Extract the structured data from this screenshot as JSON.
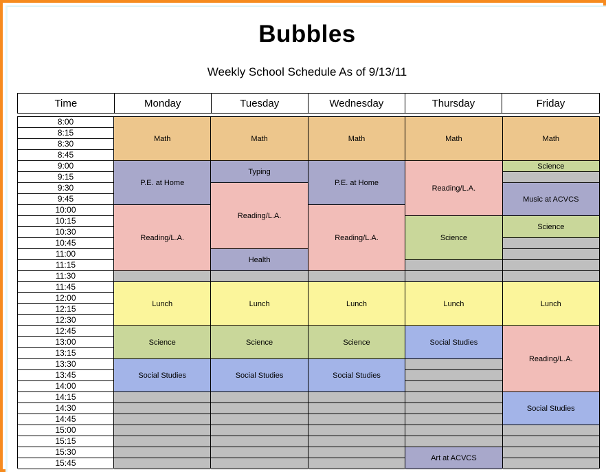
{
  "document": {
    "title": "Bubbles",
    "subtitle": "Weekly School Schedule As of 9/13/11",
    "frame_color": "#f68b1f"
  },
  "table": {
    "columns": [
      "Time",
      "Monday",
      "Tuesday",
      "Wednesday",
      "Thursday",
      "Friday"
    ],
    "times": [
      "8:00",
      "8:15",
      "8:30",
      "8:45",
      "9:00",
      "9:15",
      "9:30",
      "9:45",
      "10:00",
      "10:15",
      "10:30",
      "10:45",
      "11:00",
      "11:15",
      "11:30",
      "11:45",
      "12:00",
      "12:15",
      "12:30",
      "12:45",
      "13:00",
      "13:15",
      "13:30",
      "13:45",
      "14:00",
      "14:15",
      "14:30",
      "14:45",
      "15:00",
      "15:15",
      "15:30",
      "15:45"
    ],
    "slot_count": 32,
    "subject_colors": {
      "Math": "#edc68c",
      "P.E. at Home": "#a8a8cb",
      "Typing": "#a8a8cb",
      "Health": "#a8a8cb",
      "Music at ACVCS": "#a8a8cb",
      "Art at ACVCS": "#a8a8cb",
      "Reading/L.A.": "#f2bdb8",
      "Lunch": "#fbf59b",
      "Science": "#c9d79a",
      "Social Studies": "#a3b4e8",
      "empty": "#bfbfbf"
    },
    "days": [
      {
        "name": "Monday",
        "blocks": [
          {
            "label": "Math",
            "start": 0,
            "span": 4,
            "color": "#edc68c"
          },
          {
            "label": "P.E. at Home",
            "start": 4,
            "span": 4,
            "color": "#a8a8cb"
          },
          {
            "label": "Reading/L.A.",
            "start": 8,
            "span": 6,
            "color": "#f2bdb8"
          },
          {
            "label": "",
            "start": 14,
            "span": 1,
            "color": "#bfbfbf"
          },
          {
            "label": "Lunch",
            "start": 15,
            "span": 4,
            "color": "#fbf59b"
          },
          {
            "label": "Science",
            "start": 19,
            "span": 3,
            "color": "#c9d79a"
          },
          {
            "label": "Social Studies",
            "start": 22,
            "span": 3,
            "color": "#a3b4e8"
          },
          {
            "label": "",
            "start": 25,
            "span": 7,
            "color": "#bfbfbf"
          }
        ]
      },
      {
        "name": "Tuesday",
        "blocks": [
          {
            "label": "Math",
            "start": 0,
            "span": 4,
            "color": "#edc68c"
          },
          {
            "label": "Typing",
            "start": 4,
            "span": 2,
            "color": "#a8a8cb"
          },
          {
            "label": "Reading/L.A.",
            "start": 6,
            "span": 6,
            "color": "#f2bdb8"
          },
          {
            "label": "Health",
            "start": 12,
            "span": 2,
            "color": "#a8a8cb"
          },
          {
            "label": "",
            "start": 14,
            "span": 1,
            "color": "#bfbfbf"
          },
          {
            "label": "Lunch",
            "start": 15,
            "span": 4,
            "color": "#fbf59b"
          },
          {
            "label": "Science",
            "start": 19,
            "span": 3,
            "color": "#c9d79a"
          },
          {
            "label": "Social Studies",
            "start": 22,
            "span": 3,
            "color": "#a3b4e8"
          },
          {
            "label": "",
            "start": 25,
            "span": 7,
            "color": "#bfbfbf"
          }
        ]
      },
      {
        "name": "Wednesday",
        "blocks": [
          {
            "label": "Math",
            "start": 0,
            "span": 4,
            "color": "#edc68c"
          },
          {
            "label": "P.E. at Home",
            "start": 4,
            "span": 4,
            "color": "#a8a8cb"
          },
          {
            "label": "Reading/L.A.",
            "start": 8,
            "span": 6,
            "color": "#f2bdb8"
          },
          {
            "label": "",
            "start": 14,
            "span": 1,
            "color": "#bfbfbf"
          },
          {
            "label": "Lunch",
            "start": 15,
            "span": 4,
            "color": "#fbf59b"
          },
          {
            "label": "Science",
            "start": 19,
            "span": 3,
            "color": "#c9d79a"
          },
          {
            "label": "Social Studies",
            "start": 22,
            "span": 3,
            "color": "#a3b4e8"
          },
          {
            "label": "",
            "start": 25,
            "span": 7,
            "color": "#bfbfbf"
          }
        ]
      },
      {
        "name": "Thursday",
        "blocks": [
          {
            "label": "Math",
            "start": 0,
            "span": 4,
            "color": "#edc68c"
          },
          {
            "label": "Reading/L.A.",
            "start": 4,
            "span": 5,
            "color": "#f2bdb8"
          },
          {
            "label": "Science",
            "start": 9,
            "span": 4,
            "color": "#c9d79a"
          },
          {
            "label": "",
            "start": 13,
            "span": 2,
            "color": "#bfbfbf"
          },
          {
            "label": "Lunch",
            "start": 15,
            "span": 4,
            "color": "#fbf59b"
          },
          {
            "label": "Social Studies",
            "start": 19,
            "span": 3,
            "color": "#a3b4e8"
          },
          {
            "label": "",
            "start": 22,
            "span": 8,
            "color": "#bfbfbf"
          },
          {
            "label": "Art at ACVCS",
            "start": 30,
            "span": 2,
            "color": "#a8a8cb"
          }
        ]
      },
      {
        "name": "Friday",
        "blocks": [
          {
            "label": "Math",
            "start": 0,
            "span": 4,
            "color": "#edc68c"
          },
          {
            "label": "Science",
            "start": 4,
            "span": 1,
            "color": "#c9d79a"
          },
          {
            "label": "",
            "start": 5,
            "span": 1,
            "color": "#bfbfbf"
          },
          {
            "label": "Music at ACVCS",
            "start": 6,
            "span": 3,
            "color": "#a8a8cb"
          },
          {
            "label": "Science",
            "start": 9,
            "span": 2,
            "color": "#c9d79a"
          },
          {
            "label": "",
            "start": 11,
            "span": 4,
            "color": "#bfbfbf"
          },
          {
            "label": "Lunch",
            "start": 15,
            "span": 4,
            "color": "#fbf59b"
          },
          {
            "label": "Reading/L.A.",
            "start": 19,
            "span": 6,
            "color": "#f2bdb8"
          },
          {
            "label": "Social Studies",
            "start": 25,
            "span": 3,
            "color": "#a3b4e8"
          },
          {
            "label": "",
            "start": 28,
            "span": 4,
            "color": "#bfbfbf"
          }
        ]
      }
    ]
  }
}
